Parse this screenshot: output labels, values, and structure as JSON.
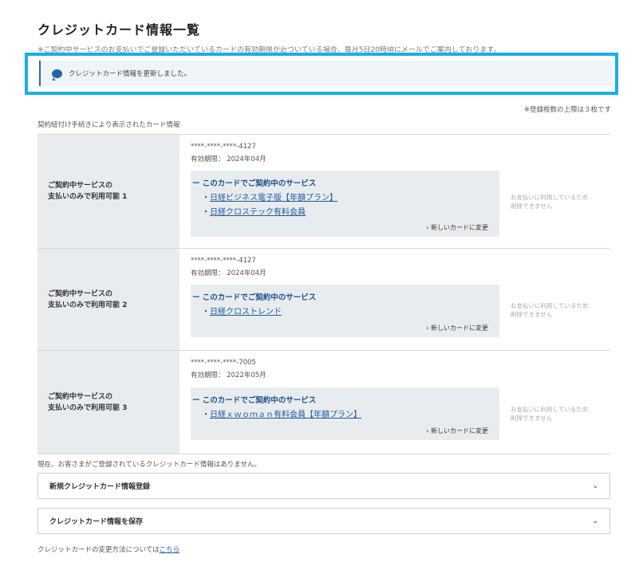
{
  "page": {
    "title": "クレジットカード情報一覧",
    "notice": "※ご契約中サービスのお支払いでご登録いただいているカードの有効期限が近づいている場合、毎月5日20時頃にメールでご案内しております。"
  },
  "alert": {
    "icon": "speech-bubble-icon",
    "message": "クレジットカード情報を更新しました。",
    "border_color": "#16b0e6",
    "icon_color": "#2366a6"
  },
  "limit_note": "※登録枚数の上限は３枚です",
  "section_label": "契約紐付け手続きにより表示されたカード情報",
  "cards": [
    {
      "head_line1": "ご契約中サービスの",
      "head_line2": "支払いのみで利用可能 1",
      "number": "****-****-****-4127",
      "expiry": "有効期限： 2024年04月",
      "services_heading": "ー このカードでご契約中のサービス",
      "services": [
        "日経ビジネス電子版【年額プラン】",
        "日経クロステック有料会員"
      ],
      "change_label": "› 新しいカードに変更",
      "note_line1": "お支払いに利用しているため",
      "note_line2": "削除できません"
    },
    {
      "head_line1": "ご契約中サービスの",
      "head_line2": "支払いのみで利用可能 2",
      "number": "****-****-****-4127",
      "expiry": "有効期限： 2024年04月",
      "services_heading": "ー このカードでご契約中のサービス",
      "services": [
        "日経クロストレンド"
      ],
      "change_label": "› 新しいカードに変更",
      "note_line1": "お支払いに利用しているため",
      "note_line2": "削除できません"
    },
    {
      "head_line1": "ご契約中サービスの",
      "head_line2": "支払いのみで利用可能 3",
      "number": "****-****-****-7005",
      "expiry": "有効期限： 2022年05月",
      "services_heading": "ー このカードでご契約中のサービス",
      "services": [
        "日経ｘｗｏｍａｎ有料会員【年額プラン】"
      ],
      "change_label": "› 新しいカードに変更",
      "note_line1": "お支払いに利用しているため",
      "note_line2": "削除できません"
    }
  ],
  "no_card_text": "現在、お客さまがご登録されているクレジットカード情報はありません。",
  "accordions": [
    {
      "label": "新規クレジットカード情報登録",
      "icon": "chevron-down-icon"
    },
    {
      "label": "クレジットカード情報を保存",
      "icon": "chevron-down-icon"
    }
  ],
  "footer": {
    "text": "クレジットカードの変更方法については",
    "link": "こちら"
  }
}
